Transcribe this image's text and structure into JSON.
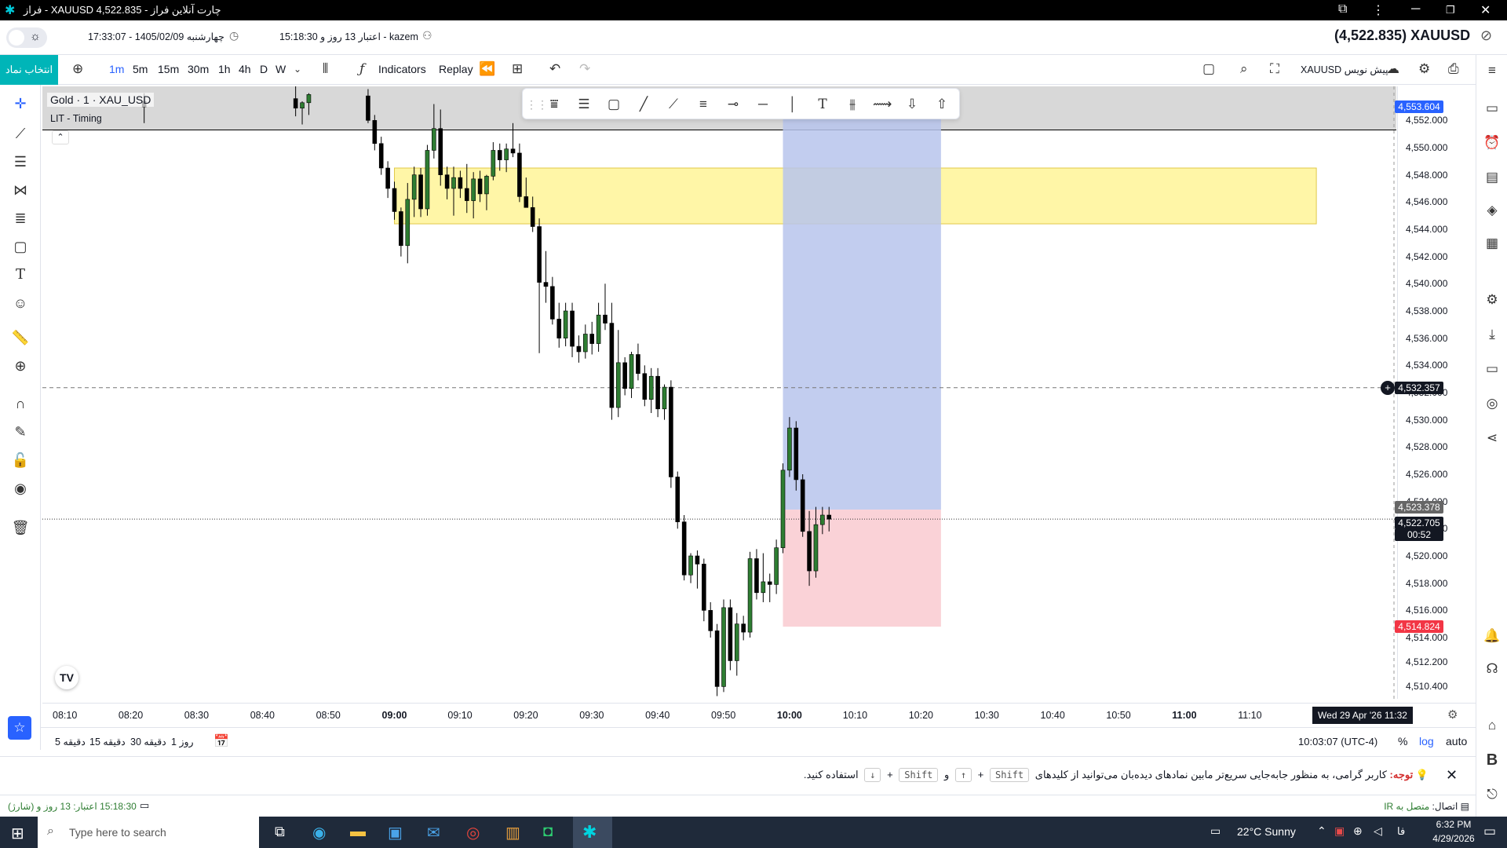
{
  "window": {
    "title": "فراز - XAUUSD 4,522.835 - چارت آنلاین فراز"
  },
  "infobar": {
    "clock": "17:33:07 - 1405/02/09 چهارشنبه",
    "credit_user": "15:18:30 اعتبار 13 روز و - kazem",
    "symbol_price": "(4,522.835) XAUUSD"
  },
  "toolbar": {
    "select_symbol": "انتخاب نماد",
    "intervals": [
      "1m",
      "5m",
      "15m",
      "30m",
      "1h",
      "4h",
      "D",
      "W"
    ],
    "active_interval": "1m",
    "indicators": "Indicators",
    "replay": "Replay",
    "pre_write": "XAUUSD پیش نویس"
  },
  "legend": {
    "title": "Gold · 1 · XAU_USD",
    "indicator": "LIT - Timing"
  },
  "price_axis": {
    "labels": [
      "4,552.000",
      "4,550.000",
      "4,548.000",
      "4,546.000",
      "4,544.000",
      "4,542.000",
      "4,540.000",
      "4,538.000",
      "4,536.000",
      "4,534.000",
      "4,532.000",
      "4,530.000",
      "4,528.000",
      "4,526.000",
      "4,524.000",
      "4,522.000",
      "4,520.000",
      "4,518.000",
      "4,516.000",
      "4,514.000",
      "4,512.200",
      "4,510.400"
    ],
    "top_badge": "4,553.604",
    "crosshair_badge": "4,532.357",
    "bid_badge": "4,523.378",
    "last_badge": "4,522.705",
    "countdown": "00:52",
    "stop_badge": "4,514.824"
  },
  "time_axis": {
    "labels": [
      "08:10",
      "08:20",
      "08:30",
      "08:40",
      "08:50",
      "09:00",
      "09:10",
      "09:20",
      "09:30",
      "09:40",
      "09:50",
      "10:00",
      "10:10",
      "10:20",
      "10:30",
      "10:40",
      "10:50",
      "11:00",
      "11:10"
    ],
    "bold": [
      "09:00",
      "10:00",
      "11:00"
    ],
    "cursor_label": "Wed 29 Apr '26   11:32"
  },
  "bottombar": {
    "ranges": [
      "5 دقیقه",
      "15 دقیقه",
      "30 دقیقه",
      "1 روز"
    ],
    "time": "10:03:07 (UTC-4)",
    "percent": "%",
    "log": "log",
    "auto": "auto"
  },
  "notice": {
    "label": "توجه:",
    "text": "کاربر گرامی، به منظور جابه‌جایی سریع‌تر مابین نمادهای دیده‌بان می‌توانید از کلیدهای",
    "key1": "Shift",
    "plus": "+",
    "up": "↑",
    "and": "و",
    "key2": "Shift",
    "down": "↓",
    "tail": "استفاده کنید."
  },
  "statusbar": {
    "credit": "(شارژ) 15:18:30 اعتبار: 13 روز و",
    "connection_label": "اتصال:",
    "connection_value": "متصل به IR"
  },
  "taskbar": {
    "search_placeholder": "Type here to search",
    "weather": "22°C  Sunny",
    "lang": "فا",
    "time": "6:32 PM",
    "date": "4/29/2026"
  },
  "colors": {
    "bull": "#2e7d32",
    "bear": "#000000",
    "supply_zone": "#fff59d",
    "target_zone": "#b7c4ec",
    "stop_zone": "#f9cdd3",
    "accent": "#2962ff",
    "brand": "#00b5b8"
  },
  "chart_data": {
    "type": "candlestick",
    "title": "Gold · 1 · XAU_USD",
    "ylim": [
      4509.5,
      4554.5
    ],
    "x_range": [
      "08:05",
      "11:20"
    ],
    "candles": [
      {
        "t": "08:22",
        "o": 4553.4,
        "h": 4554.0,
        "l": 4551.8,
        "c": 4553.0
      },
      {
        "t": "08:45",
        "o": 4553.6,
        "h": 4554.5,
        "l": 4552.3,
        "c": 4552.9
      },
      {
        "t": "08:46",
        "o": 4552.9,
        "h": 4553.4,
        "l": 4551.7,
        "c": 4553.3
      },
      {
        "t": "08:47",
        "o": 4553.3,
        "h": 4554.0,
        "l": 4552.4,
        "c": 4553.9
      },
      {
        "t": "08:56",
        "o": 4553.8,
        "h": 4554.3,
        "l": 4551.8,
        "c": 4552.0
      },
      {
        "t": "08:57",
        "o": 4552.0,
        "h": 4552.4,
        "l": 4549.8,
        "c": 4550.3
      },
      {
        "t": "08:58",
        "o": 4550.3,
        "h": 4550.8,
        "l": 4548.0,
        "c": 4548.5
      },
      {
        "t": "08:59",
        "o": 4548.5,
        "h": 4549.0,
        "l": 4546.3,
        "c": 4547.0
      },
      {
        "t": "09:00",
        "o": 4547.0,
        "h": 4547.5,
        "l": 4544.7,
        "c": 4545.3
      },
      {
        "t": "09:01",
        "o": 4545.3,
        "h": 4545.6,
        "l": 4542.0,
        "c": 4542.8
      },
      {
        "t": "09:02",
        "o": 4542.8,
        "h": 4547.4,
        "l": 4541.5,
        "c": 4546.2
      },
      {
        "t": "09:03",
        "o": 4546.2,
        "h": 4548.6,
        "l": 4544.9,
        "c": 4548.0
      },
      {
        "t": "09:04",
        "o": 4548.0,
        "h": 4548.5,
        "l": 4544.9,
        "c": 4545.5
      },
      {
        "t": "09:05",
        "o": 4545.5,
        "h": 4550.2,
        "l": 4545.0,
        "c": 4549.8
      },
      {
        "t": "09:06",
        "o": 4549.8,
        "h": 4553.2,
        "l": 4549.2,
        "c": 4551.4
      },
      {
        "t": "09:07",
        "o": 4551.4,
        "h": 4552.8,
        "l": 4547.2,
        "c": 4548.0
      },
      {
        "t": "09:08",
        "o": 4548.0,
        "h": 4548.6,
        "l": 4546.2,
        "c": 4547.0
      },
      {
        "t": "09:09",
        "o": 4547.0,
        "h": 4548.6,
        "l": 4545.0,
        "c": 4547.8
      },
      {
        "t": "09:10",
        "o": 4547.8,
        "h": 4548.3,
        "l": 4546.3,
        "c": 4547.0
      },
      {
        "t": "09:11",
        "o": 4547.0,
        "h": 4548.8,
        "l": 4545.2,
        "c": 4546.1
      },
      {
        "t": "09:12",
        "o": 4546.1,
        "h": 4548.2,
        "l": 4544.8,
        "c": 4547.7
      },
      {
        "t": "09:13",
        "o": 4547.7,
        "h": 4548.3,
        "l": 4546.0,
        "c": 4546.6
      },
      {
        "t": "09:14",
        "o": 4546.6,
        "h": 4548.0,
        "l": 4545.4,
        "c": 4547.9
      },
      {
        "t": "09:15",
        "o": 4547.9,
        "h": 4550.4,
        "l": 4547.6,
        "c": 4549.8
      },
      {
        "t": "09:16",
        "o": 4549.8,
        "h": 4550.3,
        "l": 4548.3,
        "c": 4549.1
      },
      {
        "t": "09:17",
        "o": 4549.1,
        "h": 4550.3,
        "l": 4548.2,
        "c": 4549.9
      },
      {
        "t": "09:18",
        "o": 4549.9,
        "h": 4551.8,
        "l": 4549.3,
        "c": 4549.6
      },
      {
        "t": "09:19",
        "o": 4549.6,
        "h": 4550.3,
        "l": 4546.0,
        "c": 4546.4
      },
      {
        "t": "09:20",
        "o": 4546.4,
        "h": 4547.8,
        "l": 4545.8,
        "c": 4545.6
      },
      {
        "t": "09:21",
        "o": 4545.6,
        "h": 4546.4,
        "l": 4543.8,
        "c": 4544.2
      },
      {
        "t": "09:22",
        "o": 4544.2,
        "h": 4544.8,
        "l": 4534.9,
        "c": 4540.1
      },
      {
        "t": "09:23",
        "o": 4540.1,
        "h": 4542.4,
        "l": 4538.6,
        "c": 4539.8
      },
      {
        "t": "09:24",
        "o": 4539.8,
        "h": 4540.5,
        "l": 4537.0,
        "c": 4537.4
      },
      {
        "t": "09:25",
        "o": 4537.4,
        "h": 4538.6,
        "l": 4535.3,
        "c": 4536.0
      },
      {
        "t": "09:26",
        "o": 4536.0,
        "h": 4538.6,
        "l": 4535.4,
        "c": 4538.0
      },
      {
        "t": "09:27",
        "o": 4538.0,
        "h": 4538.6,
        "l": 4534.6,
        "c": 4535.4
      },
      {
        "t": "09:28",
        "o": 4535.4,
        "h": 4536.2,
        "l": 4534.2,
        "c": 4535.0
      },
      {
        "t": "09:29",
        "o": 4535.0,
        "h": 4537.0,
        "l": 4534.5,
        "c": 4536.3
      },
      {
        "t": "09:30",
        "o": 4536.3,
        "h": 4537.2,
        "l": 4534.8,
        "c": 4535.6
      },
      {
        "t": "09:31",
        "o": 4535.6,
        "h": 4538.6,
        "l": 4535.0,
        "c": 4537.7
      },
      {
        "t": "09:32",
        "o": 4537.7,
        "h": 4540.0,
        "l": 4536.6,
        "c": 4537.1
      },
      {
        "t": "09:33",
        "o": 4537.1,
        "h": 4538.6,
        "l": 4530.0,
        "c": 4530.9
      },
      {
        "t": "09:34",
        "o": 4530.9,
        "h": 4536.6,
        "l": 4530.2,
        "c": 4534.2
      },
      {
        "t": "09:35",
        "o": 4534.2,
        "h": 4534.6,
        "l": 4531.8,
        "c": 4532.3
      },
      {
        "t": "09:36",
        "o": 4532.3,
        "h": 4535.0,
        "l": 4531.6,
        "c": 4534.8
      },
      {
        "t": "09:37",
        "o": 4534.8,
        "h": 4535.6,
        "l": 4532.9,
        "c": 4533.4
      },
      {
        "t": "09:38",
        "o": 4533.4,
        "h": 4534.0,
        "l": 4531.0,
        "c": 4531.5
      },
      {
        "t": "09:39",
        "o": 4531.5,
        "h": 4533.8,
        "l": 4530.5,
        "c": 4533.2
      },
      {
        "t": "09:40",
        "o": 4533.2,
        "h": 4533.8,
        "l": 4530.2,
        "c": 4530.8
      },
      {
        "t": "09:41",
        "o": 4530.8,
        "h": 4532.6,
        "l": 4530.0,
        "c": 4532.4
      },
      {
        "t": "09:42",
        "o": 4532.4,
        "h": 4532.9,
        "l": 4525.0,
        "c": 4525.8
      },
      {
        "t": "09:43",
        "o": 4525.8,
        "h": 4526.2,
        "l": 4522.0,
        "c": 4522.5
      },
      {
        "t": "09:44",
        "o": 4522.5,
        "h": 4523.0,
        "l": 4518.2,
        "c": 4518.6
      },
      {
        "t": "09:45",
        "o": 4518.6,
        "h": 4520.2,
        "l": 4518.0,
        "c": 4520.0
      },
      {
        "t": "09:46",
        "o": 4520.0,
        "h": 4520.4,
        "l": 4517.6,
        "c": 4519.4
      },
      {
        "t": "09:47",
        "o": 4519.4,
        "h": 4519.8,
        "l": 4515.2,
        "c": 4516.0
      },
      {
        "t": "09:48",
        "o": 4516.0,
        "h": 4516.6,
        "l": 4514.0,
        "c": 4514.5
      },
      {
        "t": "09:49",
        "o": 4514.5,
        "h": 4515.0,
        "l": 4509.7,
        "c": 4510.4
      },
      {
        "t": "09:50",
        "o": 4510.4,
        "h": 4516.8,
        "l": 4510.0,
        "c": 4516.2
      },
      {
        "t": "09:51",
        "o": 4516.2,
        "h": 4516.8,
        "l": 4511.6,
        "c": 4512.3
      },
      {
        "t": "09:52",
        "o": 4512.3,
        "h": 4515.8,
        "l": 4511.2,
        "c": 4515.0
      },
      {
        "t": "09:53",
        "o": 4515.0,
        "h": 4515.6,
        "l": 4513.8,
        "c": 4514.4
      },
      {
        "t": "09:54",
        "o": 4514.4,
        "h": 4520.3,
        "l": 4514.0,
        "c": 4519.8
      },
      {
        "t": "09:55",
        "o": 4519.8,
        "h": 4520.5,
        "l": 4516.8,
        "c": 4517.3
      },
      {
        "t": "09:56",
        "o": 4517.3,
        "h": 4520.2,
        "l": 4516.6,
        "c": 4518.1
      },
      {
        "t": "09:57",
        "o": 4518.1,
        "h": 4518.7,
        "l": 4516.6,
        "c": 4517.9
      },
      {
        "t": "09:58",
        "o": 4517.9,
        "h": 4521.2,
        "l": 4517.2,
        "c": 4520.6
      },
      {
        "t": "09:59",
        "o": 4520.6,
        "h": 4526.8,
        "l": 4520.2,
        "c": 4526.3
      },
      {
        "t": "10:00",
        "o": 4526.3,
        "h": 4530.2,
        "l": 4525.8,
        "c": 4529.4
      },
      {
        "t": "10:01",
        "o": 4529.4,
        "h": 4529.9,
        "l": 4524.8,
        "c": 4525.6
      },
      {
        "t": "10:02",
        "o": 4525.6,
        "h": 4526.0,
        "l": 4521.4,
        "c": 4521.8
      },
      {
        "t": "10:03",
        "o": 4521.8,
        "h": 4523.3,
        "l": 4517.8,
        "c": 4518.9
      },
      {
        "t": "10:04",
        "o": 4518.9,
        "h": 4523.6,
        "l": 4518.4,
        "c": 4522.3
      },
      {
        "t": "10:05",
        "o": 4522.3,
        "h": 4523.6,
        "l": 4521.6,
        "c": 4523.0
      },
      {
        "t": "10:06",
        "o": 4523.0,
        "h": 4523.6,
        "l": 4521.8,
        "c": 4522.7
      }
    ],
    "zones": [
      {
        "name": "supply",
        "from": "09:00",
        "to": "11:20",
        "y0": 4544.4,
        "y1": 4548.5
      },
      {
        "name": "target",
        "from": "09:59",
        "to": "10:23",
        "y0": 4523.4,
        "y1": 4553.6
      },
      {
        "name": "stop",
        "from": "09:59",
        "to": "10:23",
        "y0": 4514.8,
        "y1": 4523.4
      }
    ],
    "levels": {
      "crosshair": 4532.357,
      "last": 4522.705
    }
  }
}
